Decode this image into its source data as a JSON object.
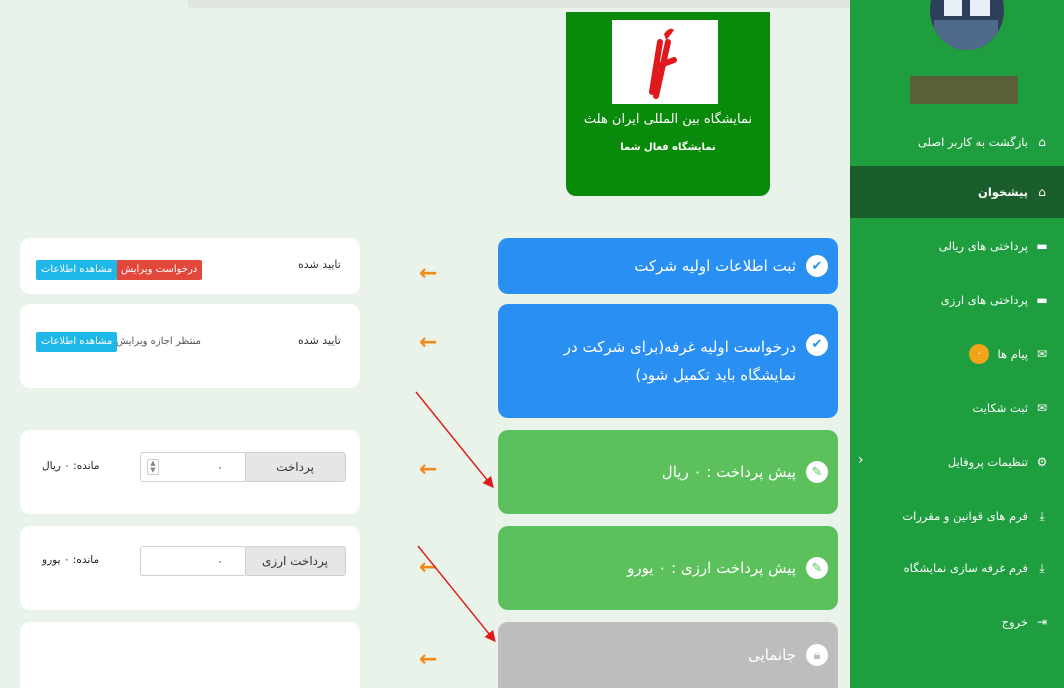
{
  "sidebar": {
    "items": [
      {
        "label": "بازگشت به کاربر اصلی",
        "icon": "home-icon"
      },
      {
        "label": "پیشخوان",
        "icon": "home-icon",
        "active": true
      },
      {
        "label": "پرداختی های ریالی",
        "icon": "card-icon"
      },
      {
        "label": "پرداختی های ارزی",
        "icon": "card-icon"
      },
      {
        "label": "پیام ها",
        "icon": "envelope-icon",
        "badge": "۰"
      },
      {
        "label": "ثبت شکایت",
        "icon": "envelope-icon"
      },
      {
        "label": "تنظیمات پروفایل",
        "icon": "gears-icon"
      },
      {
        "label": "فرم های قوانین و مقررات",
        "icon": "download-icon"
      },
      {
        "label": "فرم غرفه سازی نمایشگاه",
        "icon": "download-icon"
      },
      {
        "label": "خروج",
        "icon": "sign-out-icon"
      }
    ]
  },
  "exhibition": {
    "title": "نمایشگاه بین المللی ایران هلث",
    "subtitle": "نمایشگاه فعال شما"
  },
  "steps": [
    {
      "label": "ثبت اطلاعات اولیه شرکت",
      "icon": "check-icon",
      "color": "#2a8ff2"
    },
    {
      "label": "درخواست اولیه غرفه(برای شرکت در نمایشگاه باید تکمیل شود)",
      "icon": "check-icon",
      "color": "#2a8ff2"
    },
    {
      "label": "پیش پرداخت : ۰ ریال",
      "icon": "edit-icon",
      "color": "#5cc15c"
    },
    {
      "label": "پیش پرداخت ارزی : ۰ یورو",
      "icon": "edit-icon",
      "color": "#5cc15c"
    },
    {
      "label": "جانمایی",
      "icon": "lock-icon",
      "color": "#bdbdbd"
    }
  ],
  "panels": {
    "p1": {
      "status": "تایید شده",
      "edit_request": "درخواست ویرایش",
      "view": "مشاهده اطلاعات"
    },
    "p2": {
      "status": "تایید شده",
      "waiting": "منتظر اجازه ویرایش",
      "view": "مشاهده اطلاعات"
    },
    "p3": {
      "remaining": "مانده: ۰ ریال",
      "input_value": "۰",
      "pay_label": "پرداخت"
    },
    "p4": {
      "remaining": "مانده: ۰ یورو",
      "input_value": "۰",
      "pay_label": "پرداخت ارزی"
    }
  },
  "colors": {
    "sidebar": "#1e9e3f",
    "sidebar_active": "#1a5e2b",
    "arrow": "#f08a1e",
    "annotation": "#e0191c"
  }
}
